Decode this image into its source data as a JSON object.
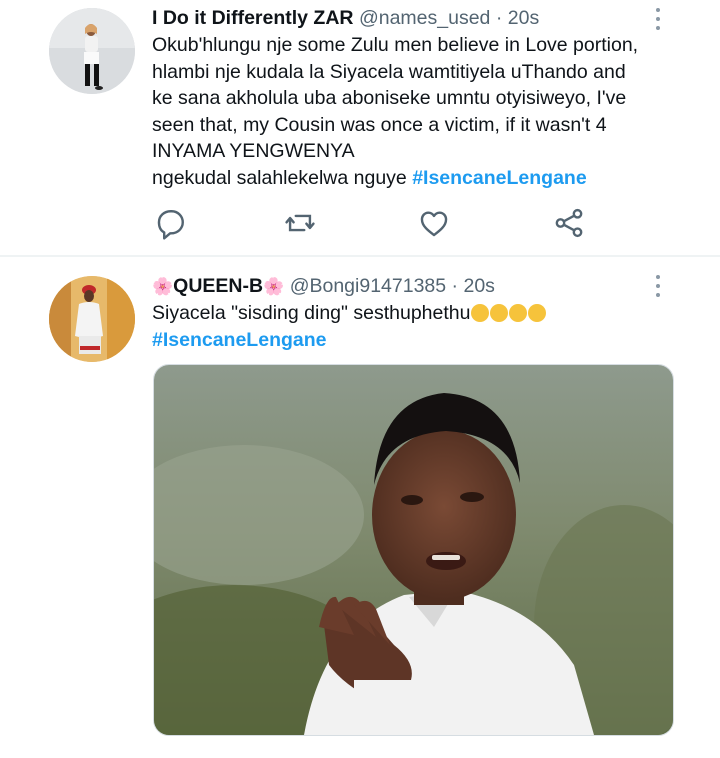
{
  "tweets": [
    {
      "display_name": "I Do it Differently ZAR",
      "handle": "@names_used",
      "separator": " · ",
      "time": "20s",
      "lines": [
        "Okub'hlungu nje some Zulu men believe in Love portion,",
        "hlambi nje kudala la Siyacela wamtitiyela uThando and",
        "ke sana akholula uba aboniseke umntu otyisiweyo, I've",
        "seen that, my Cousin was once a victim, if it wasn't 4",
        "INYAMA YENGWENYA"
      ],
      "last_line_text": "ngekudal salahlekelwa nguye ",
      "hashtag": "#IsencaneLengane",
      "actions": [
        "reply-icon",
        "retweet-icon",
        "like-icon",
        "share-icon"
      ]
    },
    {
      "flower_left": "🌸",
      "display_name": "QUEEN-B",
      "flower_right": "🌸",
      "handle": "@Bongi91471385",
      "separator": " · ",
      "time": "20s",
      "text": "Siyacela \"sisding ding\" sesthuphethu",
      "emoji_count": 4,
      "hashtag": "#IsencaneLengane",
      "media": "photo of man in white shirt gesturing with hand"
    }
  ],
  "colors": {
    "hashtag": "#1d9bf0",
    "meta": "#536471",
    "text": "#0f1419",
    "icon": "#536471"
  }
}
